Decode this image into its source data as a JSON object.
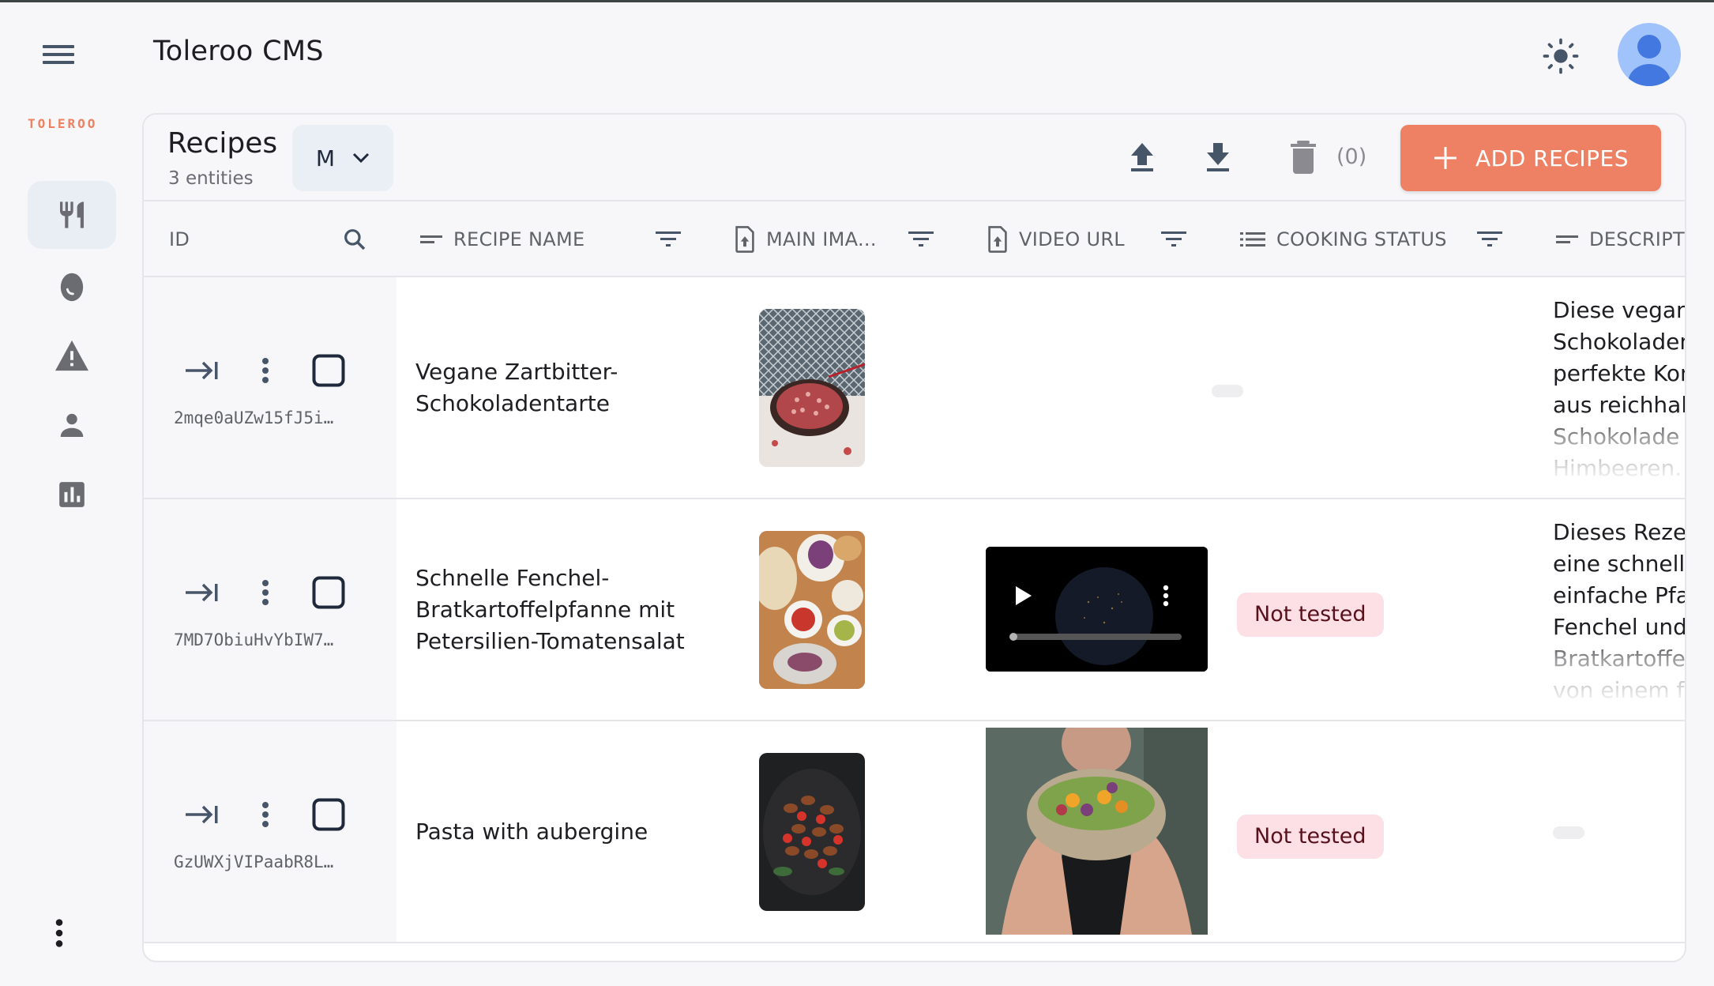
{
  "app": {
    "title": "Toleroo CMS",
    "logo": "TOLEROO",
    "icons": {
      "menu": "menu-icon",
      "theme": "sun-icon",
      "avatar": "account-circle-icon"
    }
  },
  "sidebar": {
    "items": [
      {
        "name": "recipes",
        "icon": "restaurant-icon",
        "active": true
      },
      {
        "name": "ingredients",
        "icon": "egg-icon",
        "active": false
      },
      {
        "name": "allergens",
        "icon": "warning-icon",
        "active": false
      },
      {
        "name": "users",
        "icon": "person-icon",
        "active": false
      },
      {
        "name": "analytics",
        "icon": "bar-chart-icon",
        "active": false
      }
    ],
    "more_icon": "more-vertical-icon"
  },
  "collection": {
    "title": "Recipes",
    "subtitle": "3 entities",
    "size_select": "M",
    "delete_count": "(0)",
    "add_label": "ADD RECIPES",
    "accent": "#ee8063"
  },
  "columns": [
    {
      "key": "id",
      "label": "ID"
    },
    {
      "key": "name",
      "label": "RECIPE NAME",
      "icon": "short-text-icon"
    },
    {
      "key": "main_image",
      "label": "MAIN IMA...",
      "icon": "file-upload-icon"
    },
    {
      "key": "video_url",
      "label": "VIDEO URL",
      "icon": "file-upload-icon"
    },
    {
      "key": "cooking_status",
      "label": "COOKING STATUS",
      "icon": "list-icon"
    },
    {
      "key": "description",
      "label": "DESCRIPT",
      "icon": "short-text-icon"
    }
  ],
  "rows": [
    {
      "id": "2mqe0aUZw15fJ5i…",
      "name_lines": [
        "Vegane Zartbitter-",
        "Schokoladentarte"
      ],
      "main_image": "chocolate raspberry tart",
      "video": null,
      "cooking_status": null,
      "description_lines": [
        "Diese vegan",
        "Schokoladen",
        "perfekte Kon",
        "aus reichhalt",
        "Schokolade",
        "Himbeeren."
      ]
    },
    {
      "id": "7MD7ObiuHvYbIW7…",
      "name_lines": [
        "Schnelle Fenchel-",
        "Bratkartoffelpfanne mit",
        "Petersilien-Tomatensalat"
      ],
      "main_image": "tacos and salsa spread",
      "video": "earth at night video",
      "cooking_status": "Not tested",
      "description_lines": [
        "Dieses Rezep",
        "eine schnelle",
        "einfache Pfa",
        "Fenchel und",
        "Bratkartoffe",
        "von einem fr"
      ]
    },
    {
      "id": "GzUWXjVIPaabR8L…",
      "name_lines": [
        "Pasta with aubergine"
      ],
      "main_image": "gnocchi with tomatoes",
      "video": "woman holding salad bowl",
      "cooking_status": "Not tested",
      "description_lines": []
    }
  ]
}
